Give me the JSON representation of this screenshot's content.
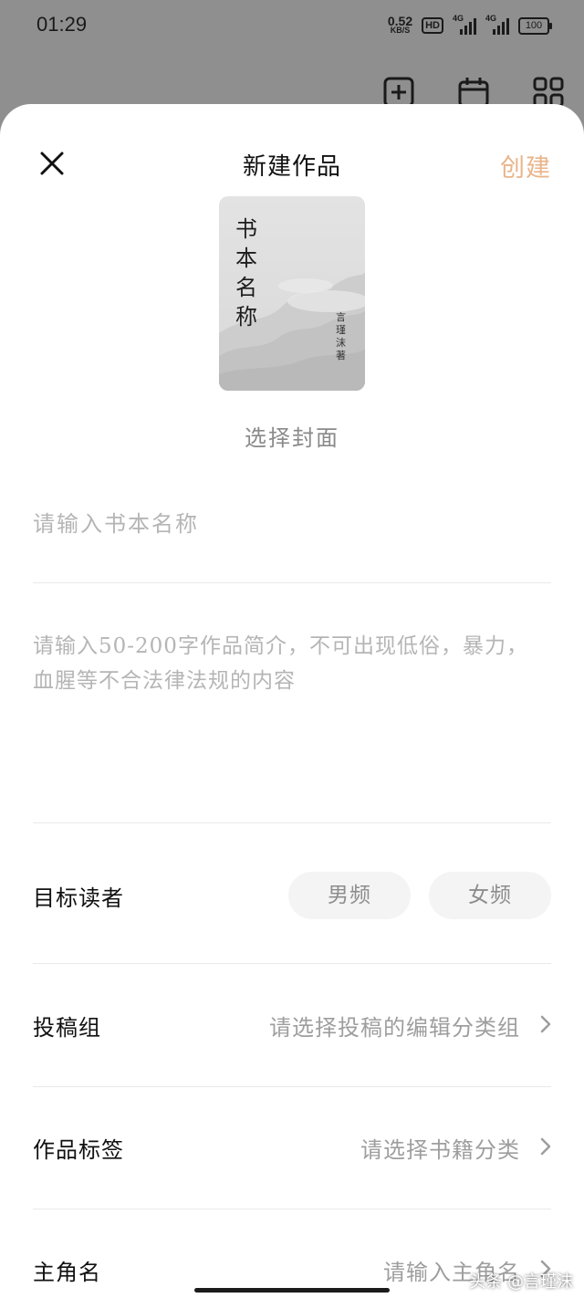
{
  "status_bar": {
    "time": "01:29",
    "net_speed_value": "0.52",
    "net_speed_unit": "KB/S",
    "hd_label": "HD",
    "signal1_label": "4G",
    "signal2_label": "4G",
    "battery": "100"
  },
  "header": {
    "title": "新建作品",
    "create_label": "创建",
    "accent_color": "#e9b48a"
  },
  "cover": {
    "book_title": "书本名称",
    "author": "言瑾沫 著",
    "select_label": "选择封面"
  },
  "form": {
    "name_placeholder": "请输入书本名称",
    "desc_placeholder": "请输入50-200字作品简介，不可出现低俗，暴力，血腥等不合法律法规的内容",
    "target_reader_label": "目标读者",
    "target_options": [
      "男频",
      "女频"
    ],
    "submission_group_label": "投稿组",
    "submission_group_placeholder": "请选择投稿的编辑分类组",
    "tags_label": "作品标签",
    "tags_placeholder": "请选择书籍分类",
    "protagonist_label": "主角名",
    "protagonist_placeholder": "请输入主角名"
  },
  "watermark": "头条 @言瑾沫"
}
